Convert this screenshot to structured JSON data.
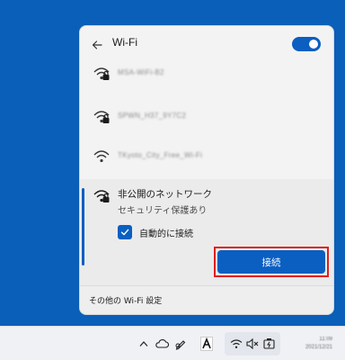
{
  "flyout": {
    "title": "Wi-Fi",
    "wifi_enabled": true,
    "accent_color": "#0a5fc1",
    "networks": [
      {
        "ssid": "MSA-WiFi-B2",
        "secured": true
      },
      {
        "ssid": "SPWN_H37_9Y7C2",
        "secured": true
      },
      {
        "ssid": "TKyoto_City_Free_Wi-Fi",
        "secured": false
      }
    ],
    "selected": {
      "name": "非公開のネットワーク",
      "status": "セキュリティ保護あり",
      "auto_connect_label": "自動的に接続",
      "auto_connect_checked": true,
      "connect_label": "接続"
    },
    "footer_link": "その他の Wi-Fi 設定"
  },
  "taskbar": {
    "tray": [
      "chevron-up-icon",
      "cloud-icon",
      "pen-icon",
      "font-icon"
    ],
    "quick_settings": [
      "wifi-icon",
      "volume-muted-icon",
      "battery-icon"
    ],
    "clock_time": "11:09",
    "clock_date": "2021/12/21"
  }
}
